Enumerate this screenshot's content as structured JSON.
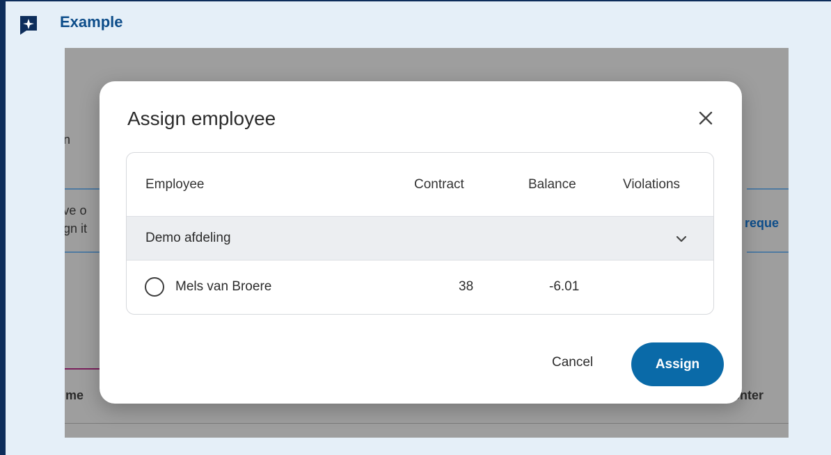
{
  "callout": {
    "title": "Example",
    "icon": "sparkle-icon",
    "border_color": "#0d2d5b",
    "background_color": "#e5eff8"
  },
  "background": {
    "fragments": [
      "n",
      "'ve o",
      "ign it",
      "e reque",
      "time",
      "enter"
    ]
  },
  "modal": {
    "title": "Assign employee",
    "close_icon": "close-icon",
    "table": {
      "headers": {
        "employee": "Employee",
        "contract": "Contract",
        "balance": "Balance",
        "violations": "Violations"
      },
      "group": {
        "label": "Demo afdeling",
        "icon": "chevron-down-icon"
      },
      "rows": [
        {
          "name": "Mels van Broere",
          "contract": "38",
          "balance": "-6.01",
          "violations": ""
        }
      ]
    },
    "buttons": {
      "cancel": "Cancel",
      "assign": "Assign"
    },
    "accent_color": "#0a6aa8"
  }
}
